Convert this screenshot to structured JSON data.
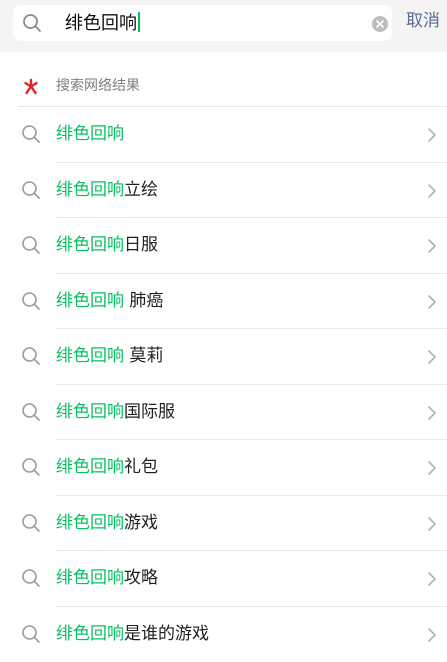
{
  "search": {
    "query": "绯色回响",
    "cancel_label": "取消"
  },
  "section": {
    "title": "搜索网络结果",
    "logo_color": "#e0242a"
  },
  "accent_color": "#07c160",
  "suggestions": [
    {
      "highlight": "绯色回响",
      "rest": ""
    },
    {
      "highlight": "绯色回响",
      "rest": "立绘"
    },
    {
      "highlight": "绯色回响",
      "rest": "日服"
    },
    {
      "highlight": "绯色回响",
      "rest": " 肺癌"
    },
    {
      "highlight": "绯色回响",
      "rest": " 莫莉"
    },
    {
      "highlight": "绯色回响",
      "rest": "国际服"
    },
    {
      "highlight": "绯色回响",
      "rest": "礼包"
    },
    {
      "highlight": "绯色回响",
      "rest": "游戏"
    },
    {
      "highlight": "绯色回响",
      "rest": "攻略"
    },
    {
      "highlight": "绯色回响",
      "rest": "是谁的游戏"
    }
  ]
}
